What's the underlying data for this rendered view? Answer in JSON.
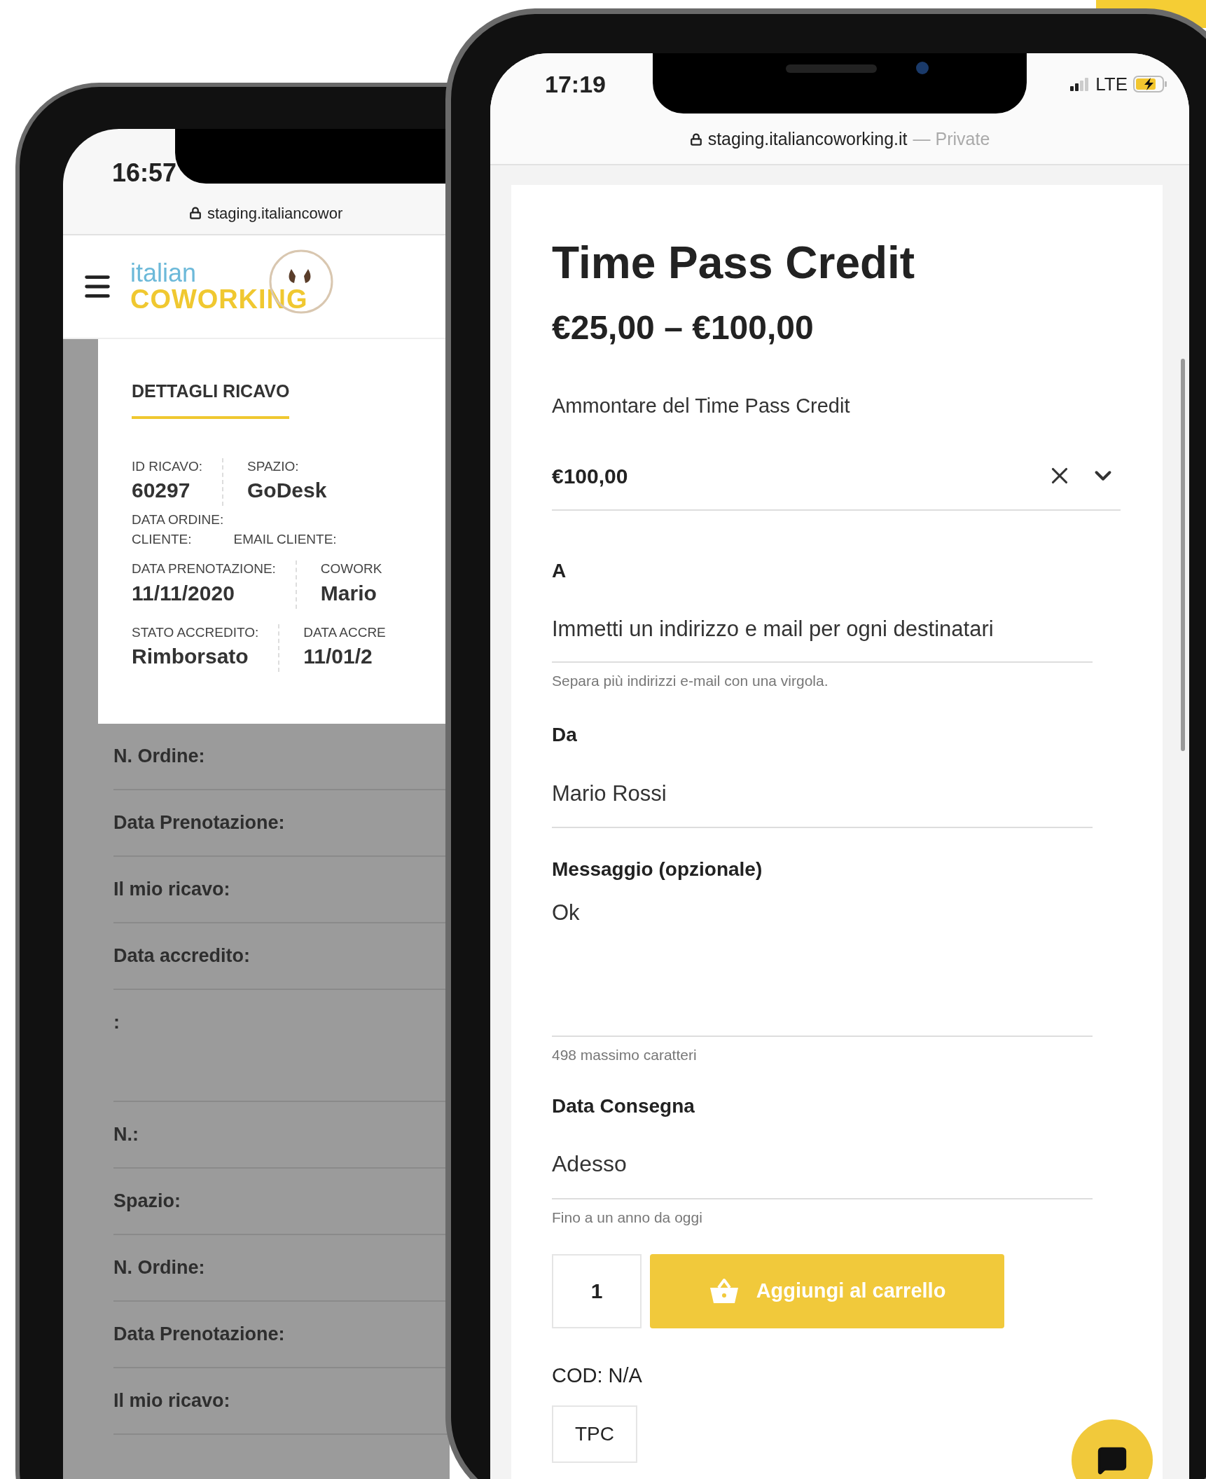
{
  "left_phone": {
    "status_bar": {
      "time": "16:57"
    },
    "address_bar": {
      "url": "staging.italiancowor"
    },
    "header": {
      "logo_top": "italian",
      "logo_bottom": "COWORKING"
    },
    "revenue_card": {
      "title": "DETTAGLI RICAVO",
      "groups": [
        {
          "kind": "pair",
          "fields": [
            {
              "label": "ID RICAVO:",
              "value": "60297"
            },
            {
              "label": "SPAZIO:",
              "value": "GoDesk"
            }
          ]
        },
        {
          "kind": "labels",
          "labels": [
            "DATA ORDINE:"
          ]
        },
        {
          "kind": "labels",
          "labels": [
            "CLIENTE:",
            "EMAIL CLIENTE:"
          ]
        },
        {
          "kind": "pair",
          "fields": [
            {
              "label": "DATA PRENOTAZIONE:",
              "value": "11/11/2020"
            },
            {
              "label": "COWORK",
              "value": "Mario"
            }
          ]
        },
        {
          "kind": "pair",
          "fields": [
            {
              "label": "STATO ACCREDITO:",
              "value": "Rimborsato"
            },
            {
              "label": "DATA ACCRE",
              "value": "11/01/2"
            }
          ]
        }
      ]
    },
    "list_rows": [
      {
        "label": "N. Ordine:",
        "kind": "single"
      },
      {
        "label": "Data Prenotazione:",
        "kind": "single"
      },
      {
        "label": "Il mio ricavo:",
        "kind": "single"
      },
      {
        "label": "Data accredito:",
        "kind": "single"
      },
      {
        "label": ":",
        "kind": "tall"
      },
      {
        "label": "N.:",
        "kind": "single"
      },
      {
        "label": "Spazio:",
        "kind": "single"
      },
      {
        "label": "N. Ordine:",
        "kind": "single"
      },
      {
        "label": "Data Prenotazione:",
        "kind": "single"
      },
      {
        "label": "Il mio ricavo:",
        "kind": "single"
      }
    ]
  },
  "right_phone": {
    "status_bar": {
      "time": "17:19",
      "network": "LTE"
    },
    "address_bar": {
      "url": "staging.italiancoworking.it",
      "mode": "— Private"
    },
    "product": {
      "title": "Time Pass Credit",
      "price_range": "€25,00 – €100,00",
      "amount_field": {
        "label": "Ammontare del Time Pass Credit",
        "value": "€100,00"
      },
      "to_field": {
        "label": "A",
        "placeholder": "Immetti un indirizzo e mail per ogni destinatari",
        "hint": "Separa più indirizzi e-mail con una virgola."
      },
      "from_field": {
        "label": "Da",
        "value": "Mario Rossi"
      },
      "message_field": {
        "label": "Messaggio (opzionale)",
        "value": "Ok",
        "hint": "498 massimo caratteri"
      },
      "delivery_field": {
        "label": "Data Consegna",
        "value": "Adesso",
        "hint": "Fino a un anno da oggi"
      },
      "quantity": "1",
      "add_to_cart": "Aggiungi al carrello",
      "sku": "COD: N/A",
      "tag": "TPC"
    }
  }
}
